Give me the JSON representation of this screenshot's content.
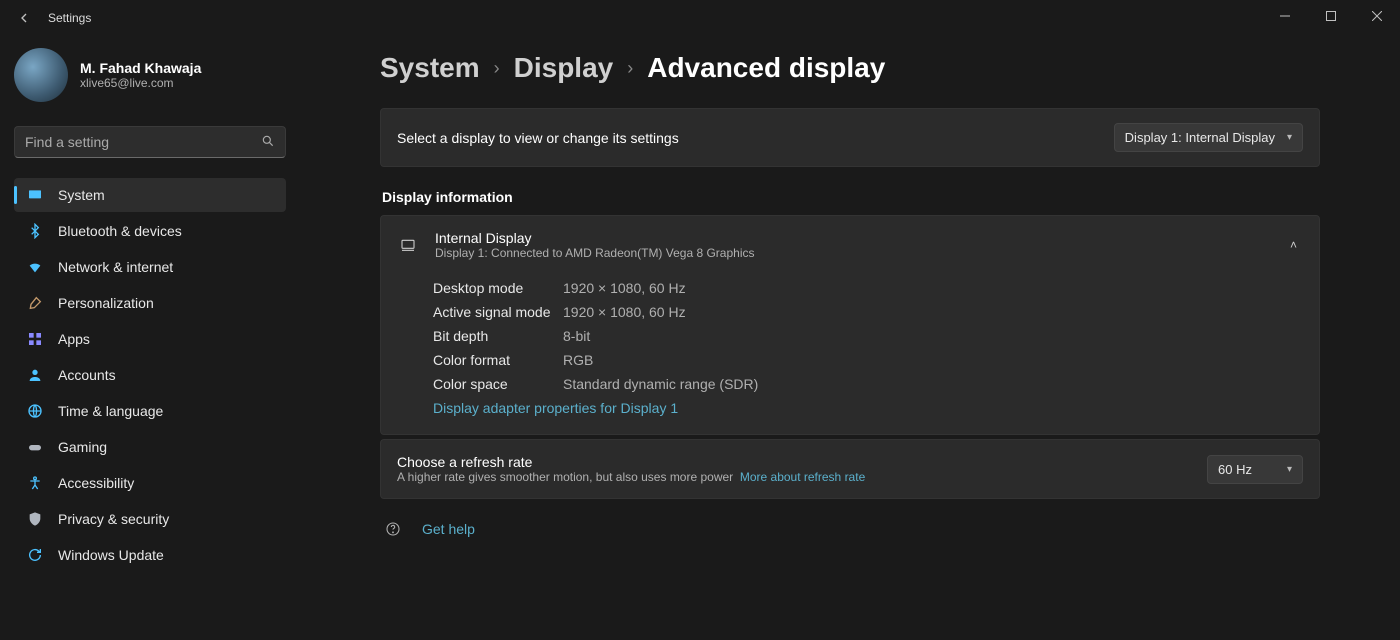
{
  "window": {
    "title": "Settings"
  },
  "user": {
    "name": "M. Fahad Khawaja",
    "email": "xlive65@live.com"
  },
  "search": {
    "placeholder": "Find a setting"
  },
  "nav": {
    "items": [
      {
        "label": "System",
        "icon": "monitor-icon",
        "color": "#4cc2ff",
        "selected": true
      },
      {
        "label": "Bluetooth & devices",
        "icon": "bluetooth-icon",
        "color": "#4cc2ff"
      },
      {
        "label": "Network & internet",
        "icon": "wifi-icon",
        "color": "#4cc2ff"
      },
      {
        "label": "Personalization",
        "icon": "brush-icon",
        "color": "#c49a6c"
      },
      {
        "label": "Apps",
        "icon": "apps-icon",
        "color": "#8a8aff"
      },
      {
        "label": "Accounts",
        "icon": "person-icon",
        "color": "#4cc2ff"
      },
      {
        "label": "Time & language",
        "icon": "globe-icon",
        "color": "#4cc2ff"
      },
      {
        "label": "Gaming",
        "icon": "gamepad-icon",
        "color": "#b0b6bf"
      },
      {
        "label": "Accessibility",
        "icon": "accessibility-icon",
        "color": "#4cc2ff"
      },
      {
        "label": "Privacy & security",
        "icon": "shield-icon",
        "color": "#b0b6bf"
      },
      {
        "label": "Windows Update",
        "icon": "update-icon",
        "color": "#4cc2ff"
      }
    ]
  },
  "breadcrumb": {
    "a": "System",
    "b": "Display",
    "c": "Advanced display"
  },
  "display_select": {
    "label": "Select a display to view or change its settings",
    "value": "Display 1: Internal Display"
  },
  "section_label": "Display information",
  "card": {
    "title": "Internal Display",
    "subtitle": "Display 1: Connected to AMD Radeon(TM) Vega 8 Graphics",
    "rows": [
      {
        "k": "Desktop mode",
        "v": "1920 × 1080, 60 Hz"
      },
      {
        "k": "Active signal mode",
        "v": "1920 × 1080, 60 Hz"
      },
      {
        "k": "Bit depth",
        "v": "8-bit"
      },
      {
        "k": "Color format",
        "v": "RGB"
      },
      {
        "k": "Color space",
        "v": "Standard dynamic range (SDR)"
      }
    ],
    "adapter_link": "Display adapter properties for Display 1"
  },
  "refresh": {
    "title": "Choose a refresh rate",
    "subtitle": "A higher rate gives smoother motion, but also uses more power",
    "more_link": "More about refresh rate",
    "value": "60 Hz"
  },
  "help": {
    "label": "Get help"
  }
}
